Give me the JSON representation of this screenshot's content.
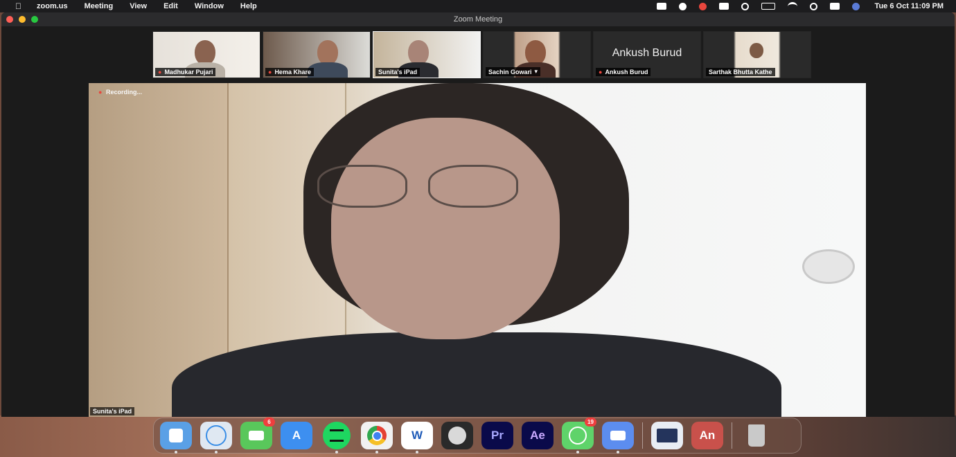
{
  "menubar": {
    "app_name": "zoom.us",
    "menus": [
      "Meeting",
      "View",
      "Edit",
      "Window",
      "Help"
    ],
    "clock": "Tue 6 Oct  11:09 PM"
  },
  "window": {
    "title": "Zoom Meeting"
  },
  "gallery": [
    {
      "name": "Madhukar Pujari",
      "muted": true,
      "video": true
    },
    {
      "name": "Hema Khare",
      "muted": true,
      "video": true
    },
    {
      "name": "Sunita's iPad",
      "muted": false,
      "video": true,
      "active": true
    },
    {
      "name": "Sachin Gowari",
      "muted": false,
      "video": true
    },
    {
      "name": "Ankush Burud",
      "muted": true,
      "video": false,
      "display_name": "Ankush Burud"
    },
    {
      "name": "Sarthak Bhutta Kathe",
      "muted": false,
      "video": true
    }
  ],
  "main_video": {
    "recording_label": "Recording...",
    "speaker_name": "Sunita's iPad"
  },
  "dock": {
    "apps": [
      {
        "name": "Finder",
        "color": "#5aa0e6",
        "label": "",
        "running": true
      },
      {
        "name": "Safari",
        "color": "#dfe8f2",
        "label": "",
        "running": true
      },
      {
        "name": "FaceTime",
        "color": "#59c75b",
        "label": "",
        "running": false,
        "badge": "6"
      },
      {
        "name": "App Store",
        "color": "#3d8ff0",
        "label": "A",
        "running": false
      },
      {
        "name": "Spotify",
        "color": "#1ed760",
        "label": "",
        "running": true
      },
      {
        "name": "Chrome",
        "color": "#f1f1f1",
        "label": "",
        "running": true
      },
      {
        "name": "Word",
        "color": "#ffffff",
        "label": "W",
        "running": true
      },
      {
        "name": "Disk Utility",
        "color": "#2a2a2a",
        "label": "",
        "running": false
      },
      {
        "name": "Premiere Pro",
        "color": "#0a0a4a",
        "label": "Pr",
        "running": false
      },
      {
        "name": "After Effects",
        "color": "#0a0a4a",
        "label": "Ae",
        "running": false
      },
      {
        "name": "WhatsApp",
        "color": "#5fd36a",
        "label": "",
        "running": true,
        "badge": "19"
      },
      {
        "name": "Zoom",
        "color": "#5c8def",
        "label": "",
        "running": true
      },
      {
        "name": "Preview",
        "color": "#e8edf4",
        "label": "",
        "running": false
      },
      {
        "name": "Acrobat",
        "color": "#c9514b",
        "label": "An",
        "running": false
      },
      {
        "name": "Trash",
        "color": "#c9c9c9",
        "label": "",
        "running": false
      }
    ]
  }
}
